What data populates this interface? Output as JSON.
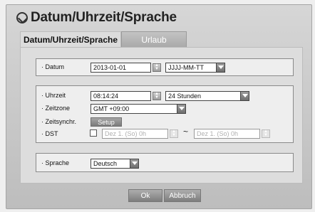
{
  "window": {
    "title": "Datum/Uhrzeit/Sprache"
  },
  "tabs": [
    {
      "label": "Datum/Uhrzeit/Sprache",
      "active": true
    },
    {
      "label": "Urlaub",
      "active": false
    }
  ],
  "date_section": {
    "date_label": "· Datum",
    "date_value": "2013-01-01",
    "date_format": "JJJJ-MM-TT"
  },
  "time_section": {
    "time_label": "· Uhrzeit",
    "time_value": "08:14:24",
    "time_format": "24 Stunden",
    "timezone_label": "· Zeitzone",
    "timezone_value": "GMT +09:00",
    "sync_label": "· Zeitsynchr.",
    "setup_button": "Setup",
    "dst_label": "· DST",
    "dst_checked": false,
    "dst_start": "Dez 1. (So) 0h",
    "dst_separator": "~",
    "dst_end": "Dez 1. (So) 0h"
  },
  "language_section": {
    "language_label": "· Sprache",
    "language_value": "Deutsch"
  },
  "footer": {
    "ok_label": "Ok",
    "cancel_label": "Abbruch"
  }
}
